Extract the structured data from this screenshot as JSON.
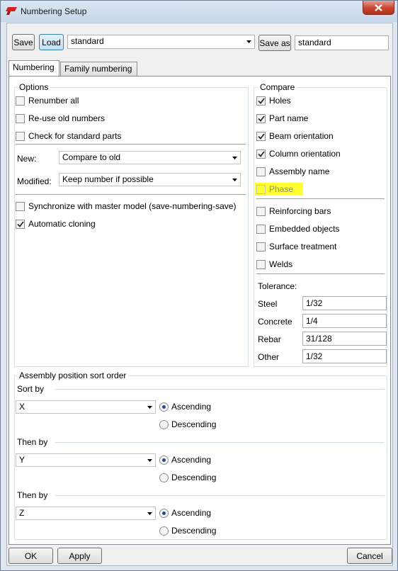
{
  "window": {
    "title": "Numbering Setup",
    "close_icon": "close-icon"
  },
  "toolbar": {
    "save_label": "Save",
    "load_label": "Load",
    "preset_value": "standard",
    "save_as_label": "Save as",
    "save_as_value": "standard"
  },
  "tabs": [
    {
      "label": "Numbering",
      "active": true
    },
    {
      "label": "Family numbering",
      "active": false
    }
  ],
  "options": {
    "title": "Options",
    "renumber_all": {
      "label": "Renumber all",
      "checked": false
    },
    "reuse_old": {
      "label": "Re-use old numbers",
      "checked": false
    },
    "check_standard": {
      "label": "Check for standard parts",
      "checked": false
    },
    "new_label": "New:",
    "new_value": "Compare to old",
    "modified_label": "Modified:",
    "modified_value": "Keep number if possible",
    "sync": {
      "label": "Synchronize with master model (save-numbering-save)",
      "checked": false
    },
    "auto_cloning": {
      "label": "Automatic cloning",
      "checked": true
    }
  },
  "compare": {
    "title": "Compare",
    "items": [
      {
        "label": "Holes",
        "checked": true
      },
      {
        "label": "Part name",
        "checked": true
      },
      {
        "label": "Beam orientation",
        "checked": true
      },
      {
        "label": "Column orientation",
        "checked": true
      },
      {
        "label": "Assembly name",
        "checked": false
      },
      {
        "label": "Phase",
        "checked": false,
        "highlighted": true,
        "disabled": true
      }
    ],
    "items2": [
      {
        "label": "Reinforcing bars",
        "checked": false
      },
      {
        "label": "Embedded objects",
        "checked": false
      },
      {
        "label": "Surface treatment",
        "checked": false
      },
      {
        "label": "Welds",
        "checked": false
      }
    ],
    "tolerance_label": "Tolerance:",
    "tolerances": [
      {
        "label": "Steel",
        "value": "1/32"
      },
      {
        "label": "Concrete",
        "value": "1/4"
      },
      {
        "label": "Rebar",
        "value": "31/128"
      },
      {
        "label": "Other",
        "value": "1/32"
      }
    ]
  },
  "sort": {
    "title": "Assembly position sort order",
    "levels": [
      {
        "label": "Sort by",
        "value": "X",
        "ascending": "Ascending",
        "descending": "Descending",
        "selected": "Ascending"
      },
      {
        "label": "Then by",
        "value": "Y",
        "ascending": "Ascending",
        "descending": "Descending",
        "selected": "Ascending"
      },
      {
        "label": "Then by",
        "value": "Z",
        "ascending": "Ascending",
        "descending": "Descending",
        "selected": "Ascending"
      }
    ]
  },
  "footer": {
    "ok_label": "OK",
    "apply_label": "Apply",
    "cancel_label": "Cancel"
  },
  "colors": {
    "highlight": "#ffff33",
    "close_button": "#c8442f",
    "app_icon": "#d22020"
  }
}
